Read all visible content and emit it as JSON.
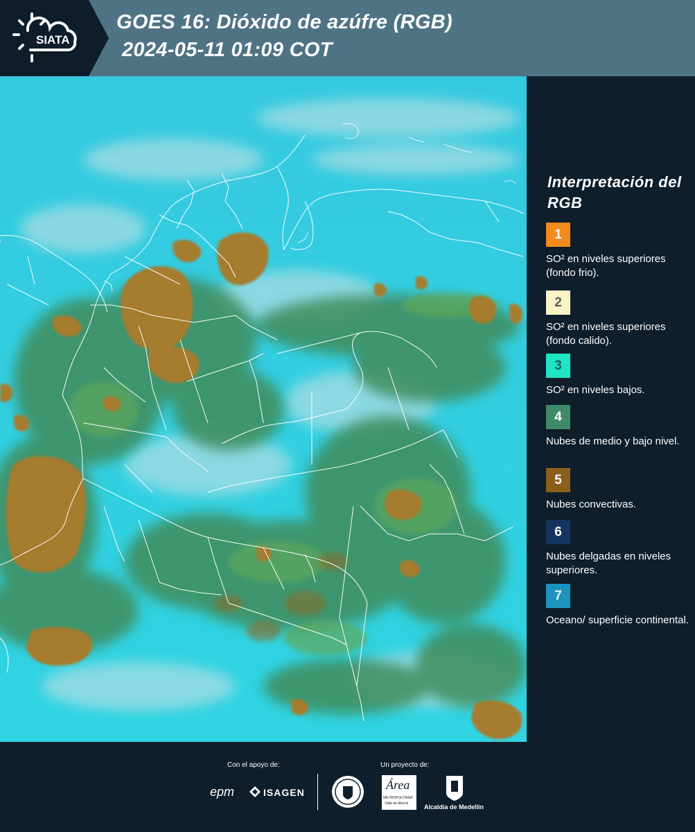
{
  "header": {
    "logo_text": "SIATA",
    "title_line1": "GOES 16: Dióxido de azúfre (RGB)",
    "title_line2": "2024-05-11 01:09 COT"
  },
  "legend": {
    "title": "Interpretación del RGB",
    "items": [
      {
        "number": "1",
        "color": "#f28a1c",
        "text_color": "#ffffff",
        "label": "SO² en niveles superiores (fondo frio)."
      },
      {
        "number": "2",
        "color": "#f9f3c6",
        "text_color": "#5a5a5a",
        "label": "SO² en niveles superiores (fondo calido)."
      },
      {
        "number": "3",
        "color": "#1ee6c5",
        "text_color": "#1f5f63",
        "label": "SO² en niveles bajos."
      },
      {
        "number": "4",
        "color": "#3f8a68",
        "text_color": "#ffffff",
        "label": "Nubes de medio y bajo nivel."
      },
      {
        "number": "5",
        "color": "#8b5e1c",
        "text_color": "#ffffff",
        "label": "Nubes convectivas."
      },
      {
        "number": "6",
        "color": "#14355f",
        "text_color": "#ffffff",
        "label": "Nubes delgadas en niveles superiores."
      },
      {
        "number": "7",
        "color": "#1c93bc",
        "text_color": "#e6f4f8",
        "label": "Oceano/ superficie continental."
      }
    ]
  },
  "footer": {
    "support_label": "Con el apoyo de:",
    "project_label": "Un proyecto de:",
    "sponsor_logos": [
      "epm",
      "ISAGEN"
    ],
    "partner_logos": [
      "Área Metropolitana",
      "Alcaldía de Medellín"
    ],
    "alcaldia_text": "Alcaldía de Medellín",
    "area_text": "Área",
    "area_subtext": "METROPOLITANA",
    "area_subtext2": "Valle de Aburrá"
  },
  "colors": {
    "header_bg": "#4e7384",
    "page_bg": "#0e1e2b",
    "ocean_cyan": "#2fd0e0",
    "cloud_green": "#3d8a5a",
    "convective_brown": "#a27a2c"
  }
}
